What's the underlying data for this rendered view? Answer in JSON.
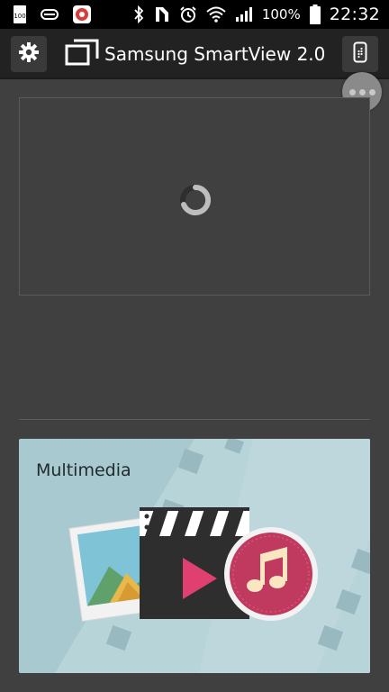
{
  "status_bar": {
    "battery_percent": "100%",
    "time": "22:32",
    "left_icons": [
      "storage-100-icon",
      "notification-icon",
      "app-notification-icon"
    ],
    "right_icons": [
      "bluetooth-icon",
      "nfc-icon",
      "alarm-icon",
      "wifi-icon",
      "signal-icon",
      "battery-icon"
    ]
  },
  "header": {
    "title": "Samsung SmartView 2.0",
    "left_button_icon": "gear-icon",
    "right_button_icon": "remote-icon"
  },
  "overflow_menu": {
    "icon": "more-dots-icon"
  },
  "device_panel": {
    "state": "loading"
  },
  "multimedia": {
    "label": "Multimedia",
    "colors": {
      "background": "#a8c9cf",
      "music_circle": "#c0395e",
      "play": "#e0406f"
    }
  },
  "colors": {
    "background": "#404040",
    "appbar": "#222222",
    "status_bar": "#000000"
  }
}
